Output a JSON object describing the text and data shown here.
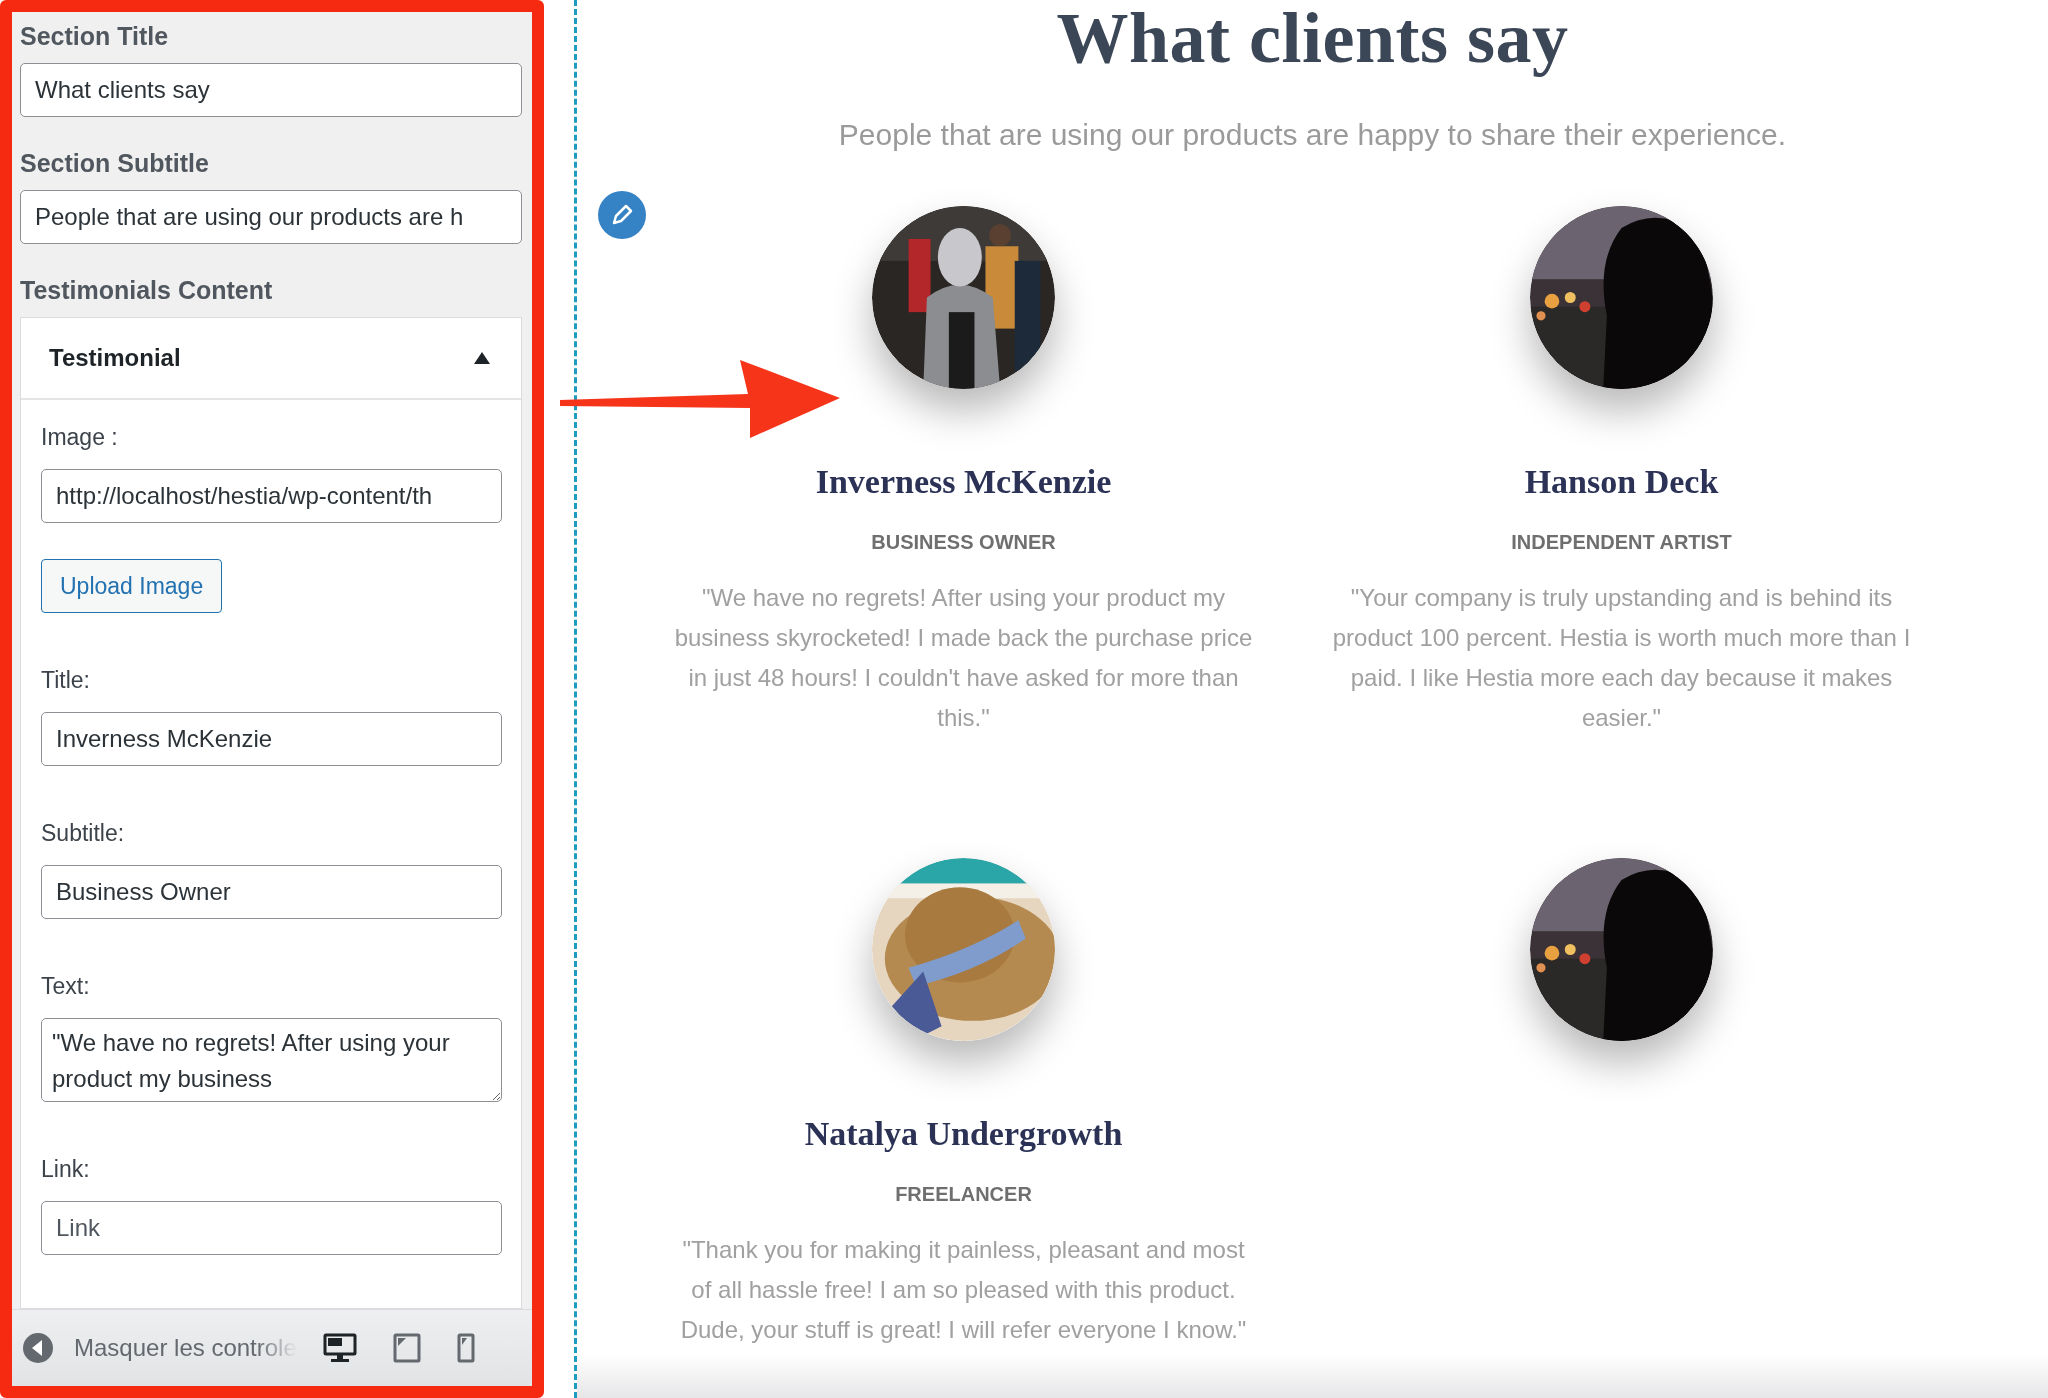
{
  "panel": {
    "section_title": {
      "label": "Section Title",
      "value": "What clients say"
    },
    "section_subtitle": {
      "label": "Section Subtitle",
      "value": "People that are using our products are h"
    },
    "content_label": "Testimonials Content",
    "testimonial": {
      "title": "Testimonial",
      "expanded": true,
      "fields": [
        {
          "kind": "input",
          "label": "Image :",
          "value": "http://localhost/hestia/wp-content/th"
        },
        {
          "kind": "button",
          "label": "Upload Image"
        },
        {
          "kind": "input",
          "label": "Title:",
          "value": "Inverness McKenzie"
        },
        {
          "kind": "input",
          "label": "Subtitle:",
          "value": "Business Owner"
        },
        {
          "kind": "textarea",
          "label": "Text:",
          "value": "\"We have no regrets! After using your product my business"
        },
        {
          "kind": "input",
          "label": "Link:",
          "placeholder": "Link"
        }
      ]
    },
    "footer": {
      "label": "Masquer les controle",
      "devices": [
        {
          "kind": "desktop",
          "selected": true
        },
        {
          "kind": "tablet",
          "selected": false
        },
        {
          "kind": "mobile",
          "selected": false
        }
      ]
    }
  },
  "preview": {
    "title": "What clients say",
    "subtitle": "People that are using our products are happy to share their experience.",
    "testimonials": [
      {
        "photo": {
          "kind": "picture"
        },
        "name": "Inverness McKenzie",
        "role": "BUSINESS OWNER",
        "text": "\"We have no regrets! After using your product my business skyrocketed! I made back the purchase price in just 48 hours! I couldn't have asked for more than this.\""
      },
      {
        "photo": {
          "kind": "picture"
        },
        "name": "Hanson Deck",
        "role": "INDEPENDENT ARTIST",
        "text": "\"Your company is truly upstanding and is behind its product 100 percent. Hestia is worth much more than I paid. I like Hestia more each day because it makes easier.\""
      },
      {
        "photo": {
          "kind": "picture"
        },
        "name": "Natalya Undergrowth",
        "role": "FREELANCER",
        "text": "\"Thank you for making it painless, pleasant and most of all hassle free! I am so pleased with this product. Dude, your stuff is great! I will refer everyone I know.\""
      },
      {
        "photo": {
          "kind": "picture"
        }
      }
    ]
  }
}
